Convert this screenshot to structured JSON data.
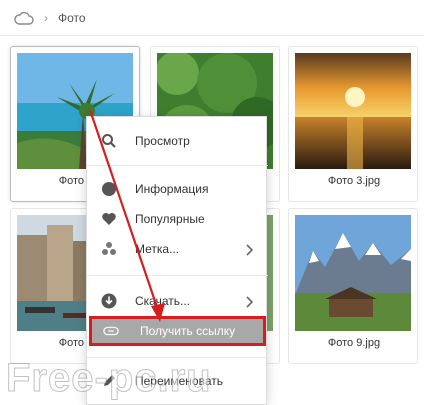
{
  "breadcrumb": {
    "home_icon": "cloud-icon",
    "current": "Фото"
  },
  "photos": [
    {
      "caption": "Фото 1",
      "selected": true
    },
    {
      "caption": "",
      "selected": false
    },
    {
      "caption": "Фото 3.jpg",
      "selected": false
    },
    {
      "caption": "Фото 7",
      "selected": false
    },
    {
      "caption": "",
      "selected": false
    },
    {
      "caption": "Фото 9.jpg",
      "selected": false
    }
  ],
  "context_menu": {
    "items": [
      {
        "label": "Просмотр",
        "icon": "search-icon"
      },
      {
        "label": "Информация",
        "icon": "info-icon"
      },
      {
        "label": "Популярные",
        "icon": "heart-icon"
      },
      {
        "label": "Метка...",
        "icon": "tag-icon",
        "submenu": true
      },
      {
        "label": "Скачать...",
        "icon": "download-icon",
        "submenu": true
      },
      {
        "label": "Получить ссылку",
        "icon": "link-icon",
        "highlighted": true
      },
      {
        "label": "Переименовать",
        "icon": "rename-icon"
      }
    ]
  },
  "watermark": "Free-pc.ru",
  "colors": {
    "highlight_border": "#d41f1f",
    "highlight_bg": "#a8a8a8",
    "arrow": "#d41f1f"
  }
}
